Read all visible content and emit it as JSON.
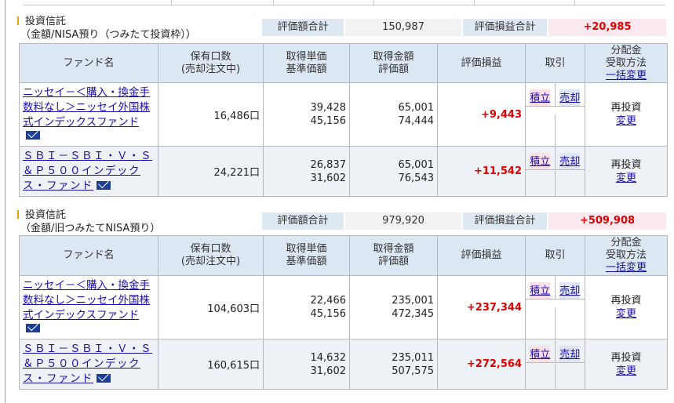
{
  "sections": [
    {
      "title_line1": "投資信託",
      "title_line2": "（金額/NISA預り（つみたて投資枠））",
      "summary": {
        "value_label": "評価額合計",
        "value": "150,987",
        "gain_label": "評価損益合計",
        "gain": "+20,985"
      },
      "headers": {
        "fund": "ファンド名",
        "qty_1": "保有口数",
        "qty_2": "(売却注文中)",
        "price_1": "取得単価",
        "price_2": "基準価額",
        "amount_1": "取得金額",
        "amount_2": "評価額",
        "gain": "評価損益",
        "trade": "取引",
        "dist_1": "分配金",
        "dist_2": "受取方法",
        "dist_link": "一括変更"
      },
      "rows": [
        {
          "fund_name": "ニッセイ－＜購入・換金手数料なし＞ニッセイ外国株式インデックスファンド",
          "qty": "16,486口",
          "cost_price": "39,428",
          "nav": "45,156",
          "cost_amount": "65,001",
          "value": "74,444",
          "gain": "+9,443",
          "buy": "積立",
          "sell": "売却",
          "reinvest": "再投資",
          "change": "変更"
        },
        {
          "fund_name": "ＳＢＩ－ＳＢＩ・Ｖ・Ｓ＆Ｐ５００インデックス・ファンド",
          "qty": "24,221口",
          "cost_price": "26,837",
          "nav": "31,602",
          "cost_amount": "65,001",
          "value": "76,543",
          "gain": "+11,542",
          "buy": "積立",
          "sell": "売却",
          "reinvest": "再投資",
          "change": "変更"
        }
      ]
    },
    {
      "title_line1": "投資信託",
      "title_line2": "（金額/旧つみたてNISA預り）",
      "summary": {
        "value_label": "評価額合計",
        "value": "979,920",
        "gain_label": "評価損益合計",
        "gain": "+509,908"
      },
      "headers": {
        "fund": "ファンド名",
        "qty_1": "保有口数",
        "qty_2": "(売却注文中)",
        "price_1": "取得単価",
        "price_2": "基準価額",
        "amount_1": "取得金額",
        "amount_2": "評価額",
        "gain": "評価損益",
        "trade": "取引",
        "dist_1": "分配金",
        "dist_2": "受取方法",
        "dist_link": "一括変更"
      },
      "rows": [
        {
          "fund_name": "ニッセイ－＜購入・換金手数料なし＞ニッセイ外国株式インデックスファンド",
          "qty": "104,603口",
          "cost_price": "22,466",
          "nav": "45,156",
          "cost_amount": "235,001",
          "value": "472,345",
          "gain": "+237,344",
          "buy": "積立",
          "sell": "売却",
          "reinvest": "再投資",
          "change": "変更"
        },
        {
          "fund_name": "ＳＢＩ－ＳＢＩ・Ｖ・Ｓ＆Ｐ５００インデックス・ファンド",
          "qty": "160,615口",
          "cost_price": "14,632",
          "nav": "31,602",
          "cost_amount": "235,011",
          "value": "507,575",
          "gain": "+272,564",
          "buy": "積立",
          "sell": "売却",
          "reinvest": "再投資",
          "change": "変更"
        }
      ]
    }
  ],
  "icons": {
    "mail": "mail-icon"
  },
  "colors": {
    "gain": "#e00000",
    "header_bg": "#dbe7f3",
    "link": "#1a0dab",
    "accent_bar": "#e0a800"
  }
}
